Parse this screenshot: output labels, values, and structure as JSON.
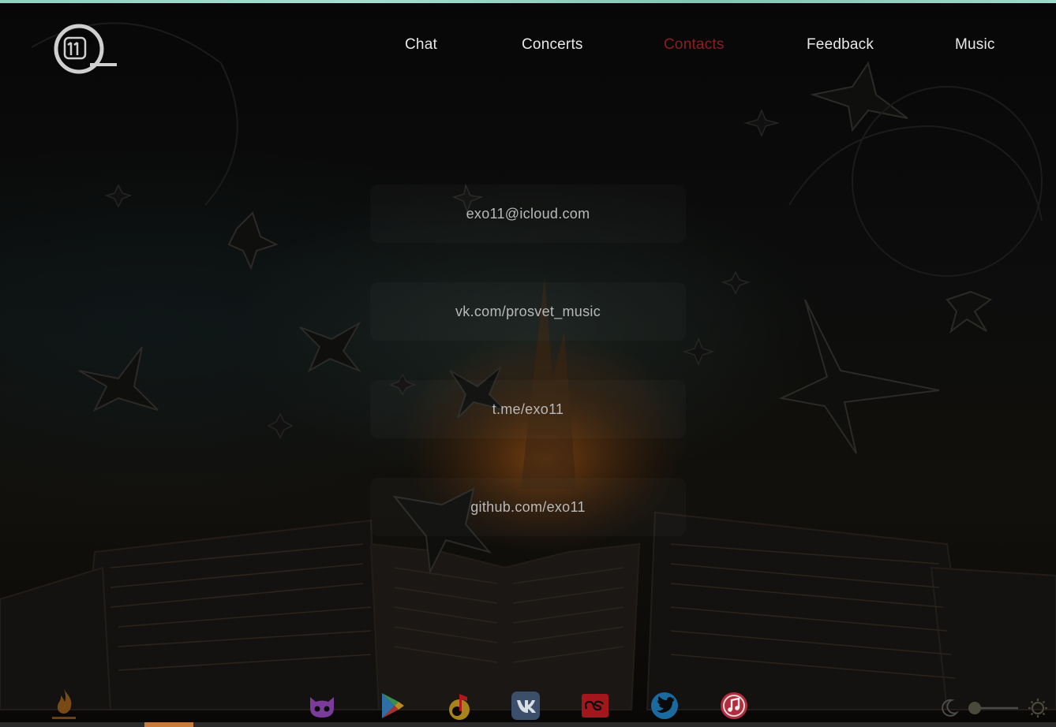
{
  "nav": {
    "items": [
      {
        "label": "Chat",
        "active": false
      },
      {
        "label": "Concerts",
        "active": false
      },
      {
        "label": "Contacts",
        "active": true
      },
      {
        "label": "Feedback",
        "active": false
      },
      {
        "label": "Music",
        "active": false
      }
    ]
  },
  "contacts": [
    {
      "label": "exo11@icloud.com"
    },
    {
      "label": "vk.com/prosvet_music"
    },
    {
      "label": "t.me/exo11"
    },
    {
      "label": "github.com/exo11"
    }
  ],
  "footer": {
    "social_icons": [
      "github-icon",
      "google-play-icon",
      "yandex-music-icon",
      "vk-icon",
      "lastfm-icon",
      "twitter-icon",
      "apple-music-icon"
    ],
    "theme": {
      "mode": "dark",
      "left_icon": "moon-icon",
      "right_icon": "sun-icon"
    }
  },
  "colors": {
    "nav_active": "#8a1f22",
    "nav_text": "#e8e8e8",
    "contact_text": "#b9b9b9",
    "top_strip": "#8bd3c0"
  }
}
